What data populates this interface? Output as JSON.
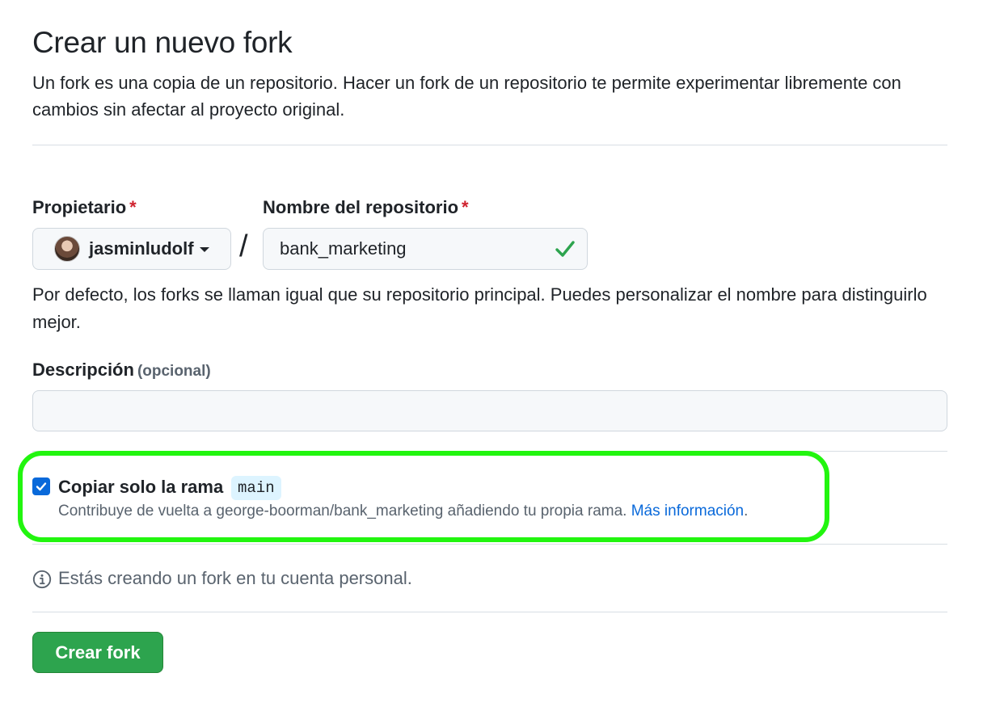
{
  "header": {
    "title": "Crear un nuevo fork",
    "subtitle": "Un fork es una copia de un repositorio. Hacer un fork de un repositorio te permite experimentar libremente con cambios sin afectar al proyecto original."
  },
  "owner": {
    "label": "Propietario",
    "required_mark": "*",
    "selected": "jasminludolf",
    "icon": "avatar"
  },
  "separator": "/",
  "repository": {
    "label": "Nombre del repositorio",
    "required_mark": "*",
    "value": "bank_marketing",
    "status_icon": "check-icon",
    "status_color": "#2da44e"
  },
  "name_help": "Por defecto, los forks se llaman igual que su repositorio principal. Puedes personalizar el nombre para distinguirlo mejor.",
  "description": {
    "label": "Descripción",
    "optional_label": "(opcional)",
    "value": ""
  },
  "branch_option": {
    "checked": true,
    "label": "Copiar solo la rama",
    "branch": "main",
    "note": "Contribuye de vuelta a george-boorman/bank_marketing añadiendo tu propia rama.",
    "link_text": "Más información",
    "link_suffix": ".",
    "highlight_color": "#22f50f"
  },
  "info": {
    "icon": "info-icon",
    "text": "Estás creando un fork en tu cuenta personal."
  },
  "submit": {
    "label": "Crear fork",
    "color": "#2da44e"
  },
  "colors": {
    "accent": "#0969da",
    "required": "#cf222e",
    "muted_text": "#59636e",
    "border": "#d0d7de"
  }
}
